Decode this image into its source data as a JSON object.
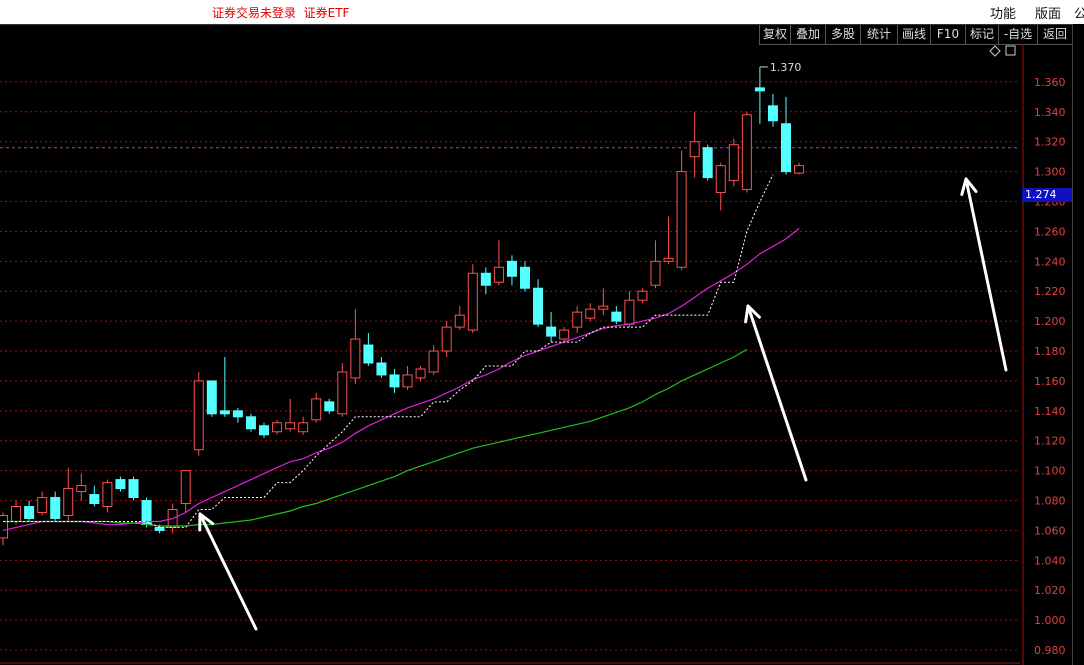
{
  "window": {
    "title": "证券交易未登录  证券ETF",
    "menu": {
      "func": "功能",
      "layout": "版面",
      "extra": "公"
    }
  },
  "toolbar": {
    "buttons": [
      "复权",
      "叠加",
      "多股",
      "统计",
      "画线",
      "F10",
      "标记",
      "-自选",
      "返回"
    ]
  },
  "colors": {
    "up": "#ff5050",
    "down": "#54ffff",
    "ma_magenta": "#e020e0",
    "ma_green": "#20c020",
    "grid": "#a01010",
    "dashed_line": "#ffffff",
    "axis_text": "#e04040"
  },
  "chart_data": {
    "type": "candlestick",
    "ylim": [
      0.97,
      1.38
    ],
    "y_ticks": [
      "1.360",
      "1.340",
      "1.320",
      "1.300",
      "1.280",
      "1.260",
      "1.240",
      "1.220",
      "1.200",
      "1.180",
      "1.160",
      "1.140",
      "1.120",
      "1.100",
      "1.080",
      "1.060",
      "1.040",
      "1.020",
      "1.000",
      "0.980"
    ],
    "current_price": "1.274",
    "high_label": "1.370",
    "reference_price": 1.316,
    "candles": [
      [
        1.055,
        1.07,
        1.05,
        1.072
      ],
      [
        1.066,
        1.076,
        1.064,
        1.08
      ],
      [
        1.076,
        1.068,
        1.066,
        1.08
      ],
      [
        1.072,
        1.082,
        1.07,
        1.086
      ],
      [
        1.082,
        1.068,
        1.066,
        1.086
      ],
      [
        1.07,
        1.088,
        1.066,
        1.102
      ],
      [
        1.086,
        1.09,
        1.08,
        1.098
      ],
      [
        1.084,
        1.078,
        1.076,
        1.09
      ],
      [
        1.076,
        1.092,
        1.072,
        1.094
      ],
      [
        1.094,
        1.088,
        1.086,
        1.096
      ],
      [
        1.094,
        1.082,
        1.08,
        1.096
      ],
      [
        1.08,
        1.064,
        1.062,
        1.082
      ],
      [
        1.062,
        1.06,
        1.058,
        1.064
      ],
      [
        1.062,
        1.074,
        1.058,
        1.078
      ],
      [
        1.078,
        1.1,
        1.072,
        1.1
      ],
      [
        1.114,
        1.16,
        1.11,
        1.166
      ],
      [
        1.16,
        1.138,
        1.136,
        1.16
      ],
      [
        1.14,
        1.138,
        1.136,
        1.176
      ],
      [
        1.14,
        1.136,
        1.132,
        1.142
      ],
      [
        1.136,
        1.128,
        1.126,
        1.138
      ],
      [
        1.13,
        1.124,
        1.122,
        1.132
      ],
      [
        1.126,
        1.132,
        1.124,
        1.134
      ],
      [
        1.128,
        1.132,
        1.126,
        1.148
      ],
      [
        1.126,
        1.132,
        1.124,
        1.136
      ],
      [
        1.134,
        1.148,
        1.132,
        1.152
      ],
      [
        1.146,
        1.14,
        1.138,
        1.148
      ],
      [
        1.138,
        1.166,
        1.136,
        1.172
      ],
      [
        1.162,
        1.188,
        1.158,
        1.208
      ],
      [
        1.184,
        1.172,
        1.17,
        1.192
      ],
      [
        1.172,
        1.164,
        1.162,
        1.176
      ],
      [
        1.164,
        1.156,
        1.152,
        1.168
      ],
      [
        1.156,
        1.164,
        1.154,
        1.17
      ],
      [
        1.162,
        1.168,
        1.16,
        1.17
      ],
      [
        1.166,
        1.18,
        1.164,
        1.184
      ],
      [
        1.18,
        1.196,
        1.176,
        1.2
      ],
      [
        1.196,
        1.204,
        1.194,
        1.21
      ],
      [
        1.194,
        1.232,
        1.192,
        1.238
      ],
      [
        1.232,
        1.224,
        1.218,
        1.236
      ],
      [
        1.226,
        1.236,
        1.224,
        1.254
      ],
      [
        1.24,
        1.23,
        1.224,
        1.244
      ],
      [
        1.236,
        1.222,
        1.22,
        1.24
      ],
      [
        1.222,
        1.198,
        1.196,
        1.228
      ],
      [
        1.196,
        1.19,
        1.186,
        1.206
      ],
      [
        1.188,
        1.194,
        1.186,
        1.196
      ],
      [
        1.196,
        1.206,
        1.192,
        1.21
      ],
      [
        1.202,
        1.208,
        1.2,
        1.212
      ],
      [
        1.208,
        1.21,
        1.204,
        1.222
      ],
      [
        1.206,
        1.2,
        1.198,
        1.21
      ],
      [
        1.198,
        1.214,
        1.196,
        1.22
      ],
      [
        1.214,
        1.22,
        1.212,
        1.222
      ],
      [
        1.224,
        1.24,
        1.222,
        1.254
      ],
      [
        1.24,
        1.242,
        1.238,
        1.27
      ],
      [
        1.236,
        1.3,
        1.234,
        1.314
      ],
      [
        1.31,
        1.32,
        1.296,
        1.34
      ],
      [
        1.316,
        1.296,
        1.294,
        1.318
      ],
      [
        1.286,
        1.304,
        1.274,
        1.306
      ],
      [
        1.294,
        1.318,
        1.29,
        1.322
      ],
      [
        1.288,
        1.338,
        1.286,
        1.34
      ],
      [
        1.356,
        1.354,
        1.332,
        1.37
      ],
      [
        1.344,
        1.334,
        1.33,
        1.352
      ],
      [
        1.332,
        1.3,
        1.298,
        1.35
      ],
      [
        1.299,
        1.304,
        1.298,
        1.306
      ]
    ],
    "ma_magenta": [
      1.06,
      1.062,
      1.064,
      1.066,
      1.066,
      1.066,
      1.066,
      1.065,
      1.064,
      1.064,
      1.065,
      1.066,
      1.066,
      1.068,
      1.072,
      1.078,
      1.082,
      1.086,
      1.09,
      1.094,
      1.098,
      1.102,
      1.106,
      1.108,
      1.112,
      1.115,
      1.119,
      1.125,
      1.13,
      1.134,
      1.138,
      1.142,
      1.145,
      1.148,
      1.152,
      1.156,
      1.161,
      1.164,
      1.168,
      1.173,
      1.177,
      1.18,
      1.183,
      1.186,
      1.189,
      1.192,
      1.195,
      1.197,
      1.198,
      1.2,
      1.202,
      1.205,
      1.21,
      1.216,
      1.222,
      1.227,
      1.232,
      1.238,
      1.245,
      1.25,
      1.255,
      1.262
    ],
    "ma_green": [
      1.066,
      1.066,
      1.066,
      1.066,
      1.066,
      1.066,
      1.066,
      1.066,
      1.066,
      1.065,
      1.065,
      1.064,
      1.063,
      1.063,
      1.063,
      1.064,
      1.064,
      1.065,
      1.066,
      1.067,
      1.069,
      1.071,
      1.073,
      1.076,
      1.078,
      1.081,
      1.084,
      1.087,
      1.09,
      1.093,
      1.096,
      1.1,
      1.103,
      1.106,
      1.109,
      1.112,
      1.115,
      1.117,
      1.119,
      1.121,
      1.123,
      1.125,
      1.127,
      1.129,
      1.131,
      1.133,
      1.136,
      1.139,
      1.142,
      1.146,
      1.151,
      1.155,
      1.16,
      1.164,
      1.168,
      1.172,
      1.176,
      1.181
    ]
  }
}
